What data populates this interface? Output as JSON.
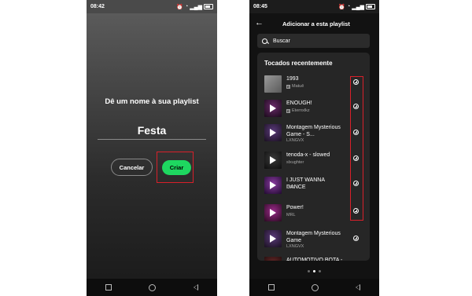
{
  "left_screen": {
    "status_time": "08:42",
    "title": "Dê um nome à sua playlist",
    "input_value": "Festa",
    "cancel_label": "Cancelar",
    "create_label": "Criar"
  },
  "right_screen": {
    "status_time": "08:45",
    "header_title": "Adicionar a esta playlist",
    "search_label": "Buscar",
    "section_title": "Tocados recentemente",
    "tracks": [
      {
        "title": "1993",
        "artist": "Matuê",
        "explicit": true
      },
      {
        "title": "ENOUGH!",
        "artist": "Eternxlkz",
        "explicit": true
      },
      {
        "title": "Montagem Mysterious Game - S...",
        "artist": "LXNGVX",
        "explicit": false
      },
      {
        "title": "tenoda-x - slowed",
        "artist": "slxughter",
        "explicit": false
      },
      {
        "title": "I JUST WANNA DANCE",
        "artist": "2KE",
        "explicit": false
      },
      {
        "title": "Power!",
        "artist": "MRL",
        "explicit": false
      },
      {
        "title": "Montagem Mysterious Game",
        "artist": "LXNGVX",
        "explicit": false
      },
      {
        "title": "AUTOMOTIVO BOTA - ...",
        "artist": "",
        "explicit": false
      }
    ],
    "page_dots": 3,
    "active_dot": 2
  },
  "colors": {
    "accent_green": "#1ed760",
    "highlight_red": "#d8202a",
    "dark_bg": "#121212",
    "card_bg": "#262626"
  },
  "explicit_badge": "E",
  "icons": [
    "wifi-icon",
    "signal-icon",
    "battery-icon",
    "alarm-icon",
    "back-arrow-icon",
    "search-icon",
    "add-circle-icon",
    "play-icon"
  ]
}
